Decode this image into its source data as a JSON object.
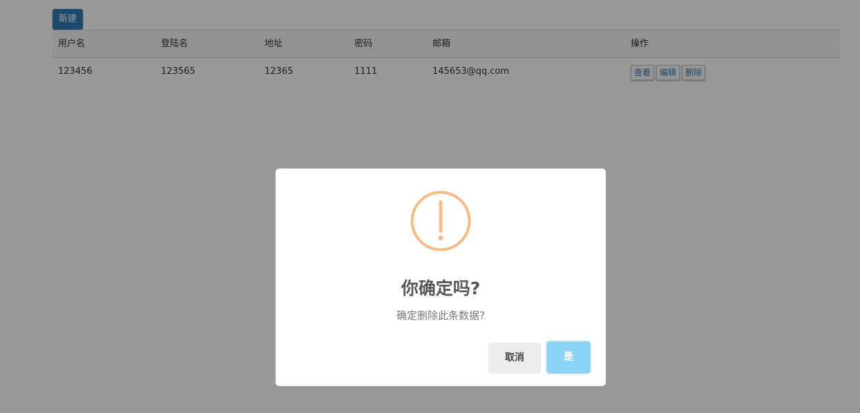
{
  "toolbar": {
    "new_label": "新建"
  },
  "table": {
    "headers": [
      "用户名",
      "登陆名",
      "地址",
      "密码",
      "邮箱",
      "操作"
    ],
    "rows": [
      {
        "username": "123456",
        "login": "123565",
        "address": "12365",
        "password": "1111",
        "email": "145653@qq.com"
      }
    ],
    "row_actions": [
      "查看",
      "编辑",
      "删除"
    ]
  },
  "dialog": {
    "icon": "warning-icon",
    "title": "你确定吗?",
    "message": "确定删除此条数据?",
    "cancel_label": "取消",
    "confirm_label": "是"
  },
  "colors": {
    "primary": "#337ab7",
    "warning": "#f8bb86",
    "confirm": "#8cd4f5"
  }
}
